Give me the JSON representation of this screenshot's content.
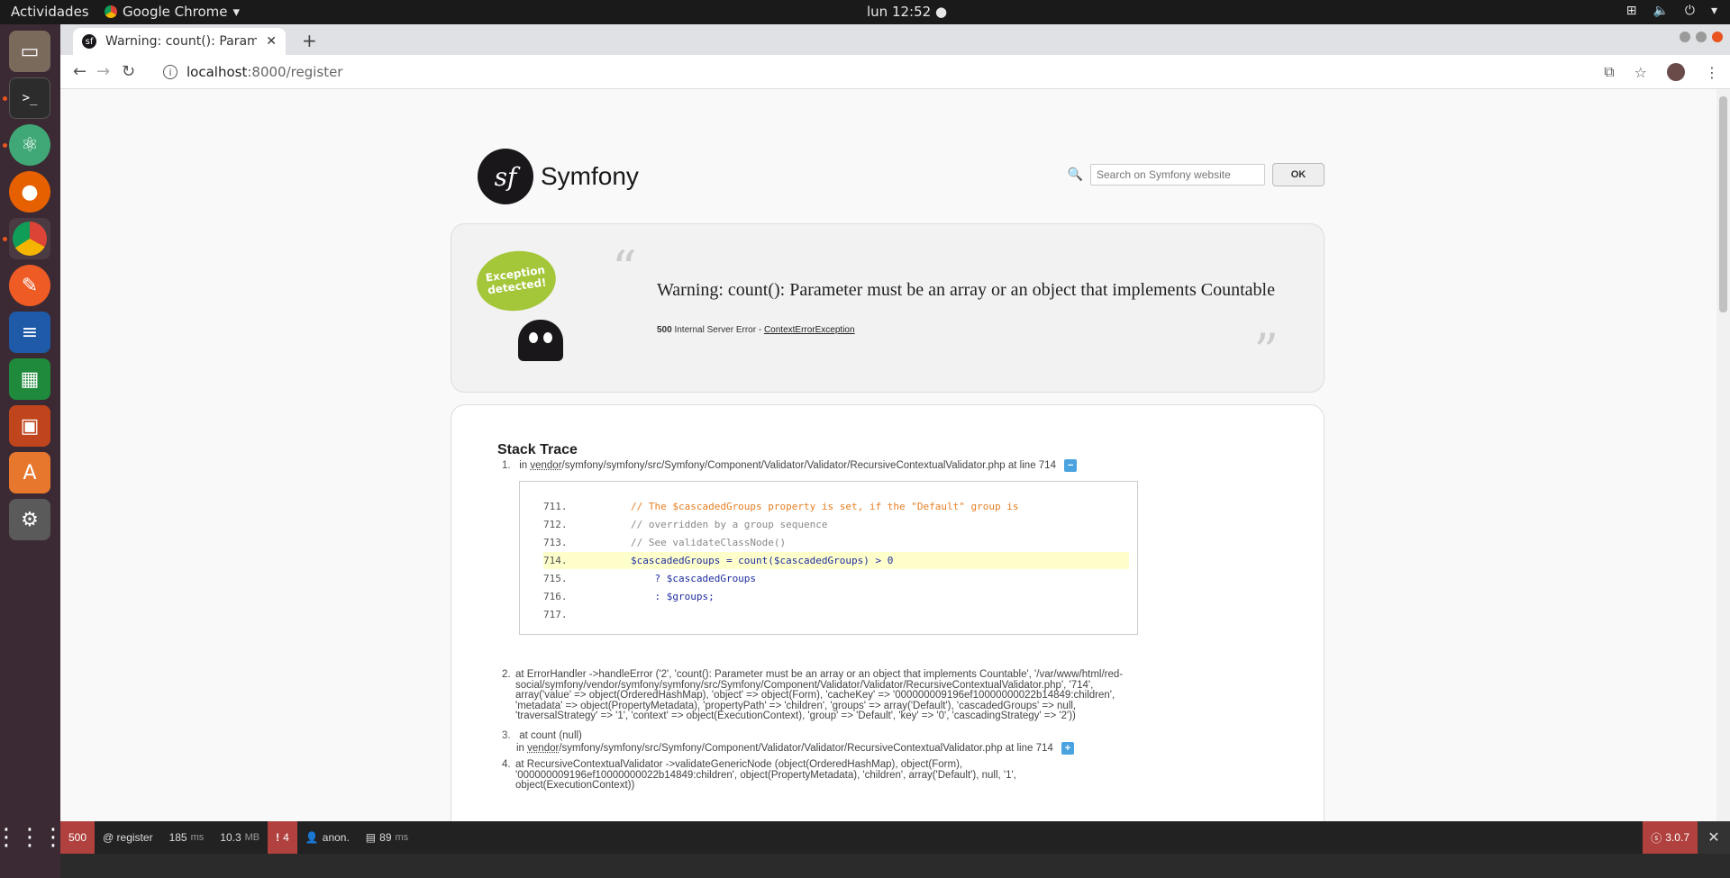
{
  "topbar": {
    "activities": "Actividades",
    "app_name": "Google Chrome",
    "clock": "lun 12:52 ●"
  },
  "dock": {
    "items": [
      "files-icon",
      "terminal-icon",
      "atom-icon",
      "firefox-icon",
      "chrome-icon",
      "postman-icon",
      "writer-icon",
      "calc-icon",
      "impress-icon",
      "software-icon",
      "settings-icon",
      "apps-grid-icon"
    ]
  },
  "browser": {
    "tab_title": "Warning: count(): Parame",
    "url_host": "localhost",
    "url_path": ":8000/register"
  },
  "symfony": {
    "logo_mark": "sf",
    "logo_text": "Symfony",
    "search_placeholder": "Search on Symfony website",
    "search_button": "OK"
  },
  "exception": {
    "bubble_text": "Exception detected!",
    "message": "Warning: count(): Parameter must be an array or an object that implements Countable",
    "status_code": "500",
    "status_text": "Internal Server Error -",
    "exception_class": "ContextErrorException"
  },
  "trace": {
    "title": "Stack Trace",
    "item1": {
      "num": "1.",
      "prefix": "in",
      "vendor": "vendor",
      "path": "/symfony/symfony/src/Symfony/Component/Validator/Validator/RecursiveContextualValidator.php at line 714",
      "toggle": "−"
    },
    "code": [
      {
        "ln": "711.",
        "text": "        // The $cascadedGroups property is set, if the \"Default\" group is"
      },
      {
        "ln": "712.",
        "text": "        // overridden by a group sequence"
      },
      {
        "ln": "713.",
        "text": "        // See validateClassNode()"
      },
      {
        "ln": "714.",
        "text": "        $cascadedGroups = count($cascadedGroups) > 0"
      },
      {
        "ln": "715.",
        "text": "            ? $cascadedGroups"
      },
      {
        "ln": "716.",
        "text": "            : $groups;"
      },
      {
        "ln": "717.",
        "text": ""
      }
    ],
    "item2": {
      "num": "2.",
      "text": "at ErrorHandler ->handleError ('2', 'count(): Parameter must be an array or an object that implements Countable', '/var/www/html/red-social/symfony/vendor/symfony/symfony/src/Symfony/Component/Validator/Validator/RecursiveContextualValidator.php', '714', array('value' => object(OrderedHashMap), 'object' => object(Form), 'cacheKey' => '000000009196ef10000000022b14849:children', 'metadata' => object(PropertyMetadata), 'propertyPath' => 'children', 'groups' => array('Default'), 'cascadedGroups' => null, 'traversalStrategy' => '1', 'context' => object(ExecutionContext), 'group' => 'Default', 'key' => '0', 'cascadingStrategy' => '2'))"
    },
    "item3": {
      "num": "3.",
      "line1": "at count (null)",
      "prefix": "in",
      "vendor": "vendor",
      "path": "/symfony/symfony/src/Symfony/Component/Validator/Validator/RecursiveContextualValidator.php at line 714",
      "toggle": "+"
    },
    "item4": {
      "num": "4.",
      "text": "at RecursiveContextualValidator ->validateGenericNode (object(OrderedHashMap), object(Form), '000000009196ef10000000022b14849:children', object(PropertyMetadata), 'children', array('Default'), null, '1', object(ExecutionContext))"
    }
  },
  "profiler": {
    "status": "500",
    "route": "@ register",
    "time_value": "185",
    "time_unit": "ms",
    "memory_value": "10.3",
    "memory_unit": "MB",
    "errors": "4",
    "user": "anon.",
    "db_time": "89",
    "db_unit": "ms",
    "version": "3.0.7",
    "close": "✕"
  }
}
